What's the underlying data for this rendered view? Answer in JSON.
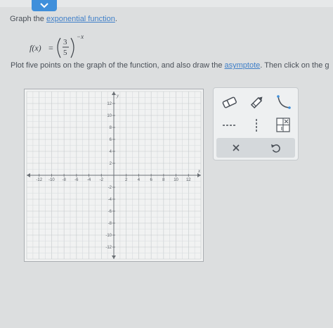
{
  "instruction": {
    "prefix": "Graph the ",
    "link": "exponential function",
    "suffix": "."
  },
  "formula": {
    "fx": "f(x)",
    "equals": "=",
    "numerator": "3",
    "denominator": "5",
    "exponent": "−x"
  },
  "instruction2": {
    "prefix": "Plot five points on the graph of the function, and also draw the ",
    "link": "asymptote",
    "suffix": ". Then click on the g"
  },
  "graph": {
    "x_axis_label": "x",
    "y_axis_label": "y",
    "x_range": [
      -14,
      14
    ],
    "y_range": [
      -14,
      14
    ],
    "x_tick_labels": [
      "-12",
      "-10",
      "-8",
      "-6",
      "-4",
      "-2",
      "2",
      "4",
      "6",
      "8",
      "10",
      "12"
    ],
    "y_tick_labels": [
      "12",
      "10",
      "8",
      "6",
      "4",
      "2",
      "-2",
      "-4",
      "-6",
      "-8",
      "-10",
      "-12"
    ]
  },
  "tools": {
    "eraser": "eraser-icon",
    "pencil": "pencil-icon",
    "curve": "exponential-curve-icon",
    "horizontal_asymptote": "horizontal-dashed-line-icon",
    "vertical_asymptote": "vertical-dashed-line-icon",
    "help": "function-help-icon",
    "clear": "close-icon",
    "undo": "undo-icon"
  },
  "colors": {
    "accent": "#3f8fdb",
    "link": "#3f7fc8",
    "text": "#4a5058"
  }
}
